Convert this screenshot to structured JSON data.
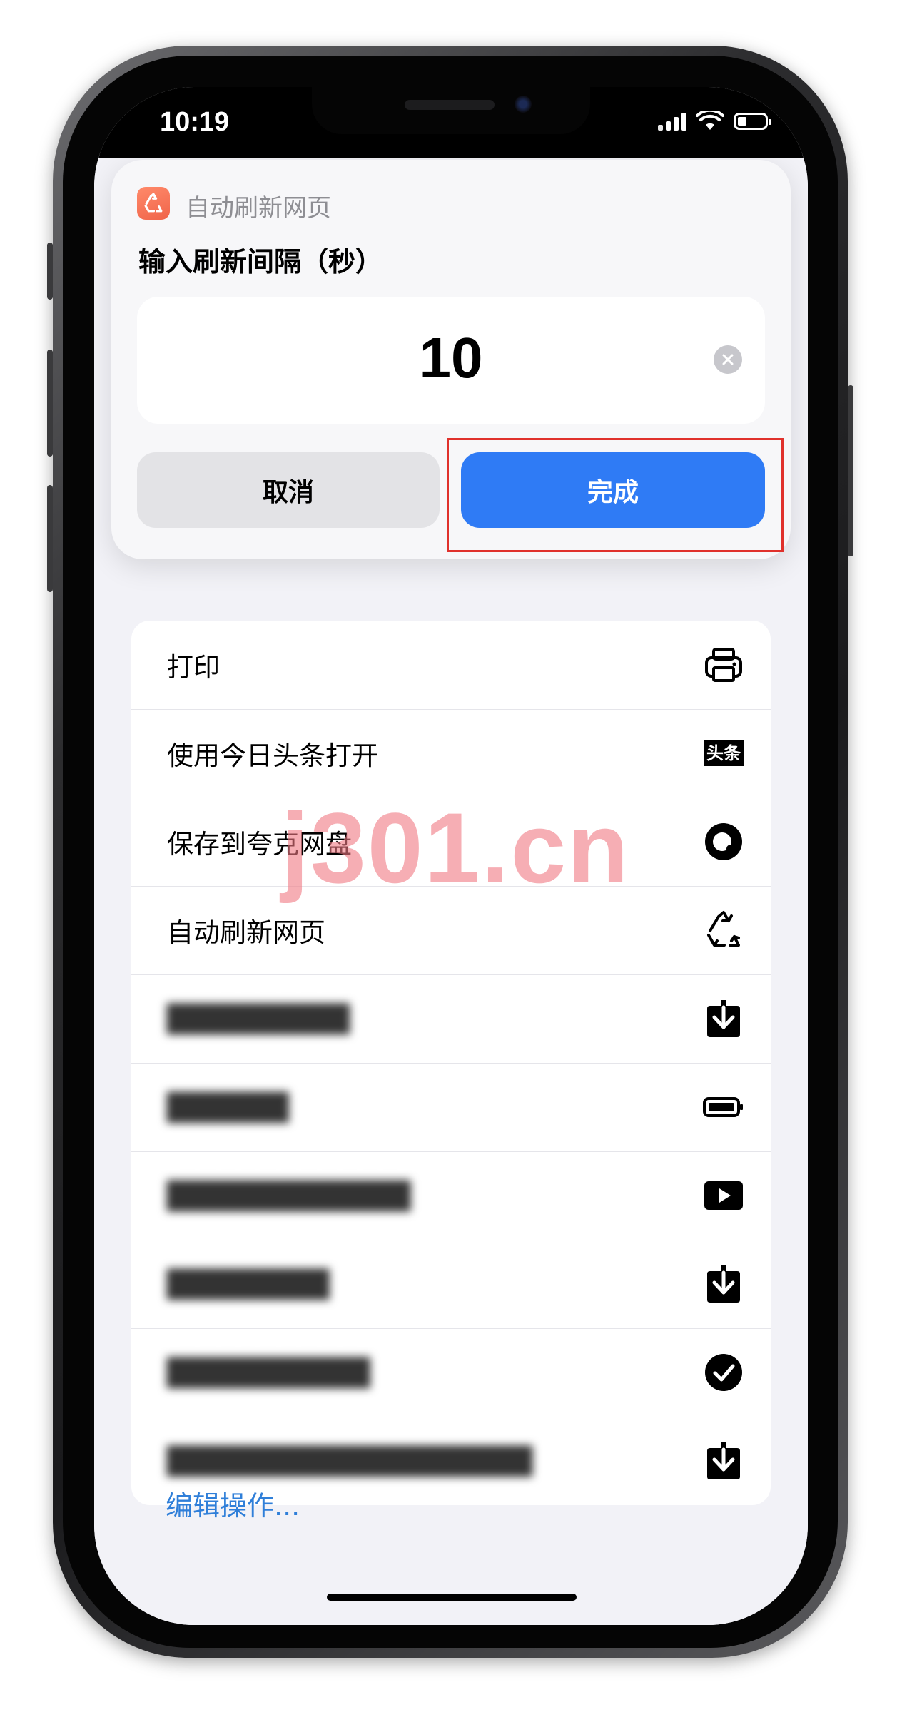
{
  "status_bar": {
    "time": "10:19"
  },
  "dialog": {
    "app_name": "自动刷新网页",
    "title": "输入刷新间隔（秒）",
    "input_value": "10",
    "cancel_label": "取消",
    "done_label": "完成"
  },
  "actions": [
    {
      "label": "打印",
      "icon": "printer-icon",
      "blurred": false
    },
    {
      "label": "使用今日头条打开",
      "icon": "toutiao-icon",
      "icon_text": "头条",
      "blurred": false
    },
    {
      "label": "保存到夸克网盘",
      "icon": "quark-icon",
      "blurred": false
    },
    {
      "label": "自动刷新网页",
      "icon": "recycle-icon",
      "blurred": false
    },
    {
      "label": "█████████",
      "icon": "download-icon",
      "blurred": true
    },
    {
      "label": "██████",
      "icon": "battery-icon",
      "blurred": true
    },
    {
      "label": "████████████",
      "icon": "play-icon",
      "blurred": true
    },
    {
      "label": "████████",
      "icon": "download-icon",
      "blurred": true
    },
    {
      "label": "██████████",
      "icon": "checkmark-icon",
      "blurred": true
    },
    {
      "label": "██████████████████",
      "icon": "download-icon",
      "blurred": true
    }
  ],
  "edit_link": "编辑操作...",
  "watermark": "j301.cn",
  "colors": {
    "accent": "#2f7bf5",
    "link": "#2f7fd9",
    "highlight": "#e0312c",
    "app_icon": "#f0644a"
  }
}
